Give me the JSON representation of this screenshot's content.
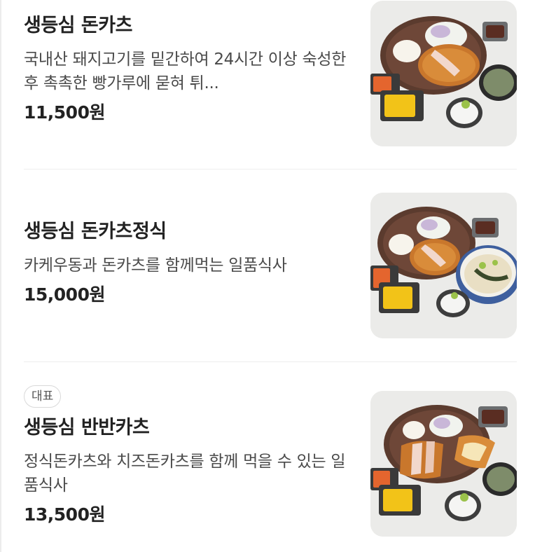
{
  "menu": {
    "items": [
      {
        "name": "생등심 돈카츠",
        "description": "국내산 돼지고기를 밑간하여 24시간 이상 숙성한후 촉촉한 빵가루에 묻혀 튀...",
        "price": "11,500원",
        "image_icon": "tonkatsu-plate-photo"
      },
      {
        "name": "생등심 돈카츠정식",
        "description": "카케우동과 돈카츠를 함께먹는 일품식사",
        "price": "15,000원",
        "image_icon": "tonkatsu-set-with-udon-photo"
      },
      {
        "badge": "대표",
        "name": "생등심 반반카츠",
        "description": "정식돈카츠와 치즈돈카츠를 함께 먹을 수 있는 일품식사",
        "price": "13,500원",
        "image_icon": "half-half-katsu-plate-photo"
      }
    ]
  },
  "colors": {
    "text_primary": "#222222",
    "text_secondary": "#4a4a4a",
    "divider": "#eeeeee",
    "photo_background": "#ebebe9"
  }
}
